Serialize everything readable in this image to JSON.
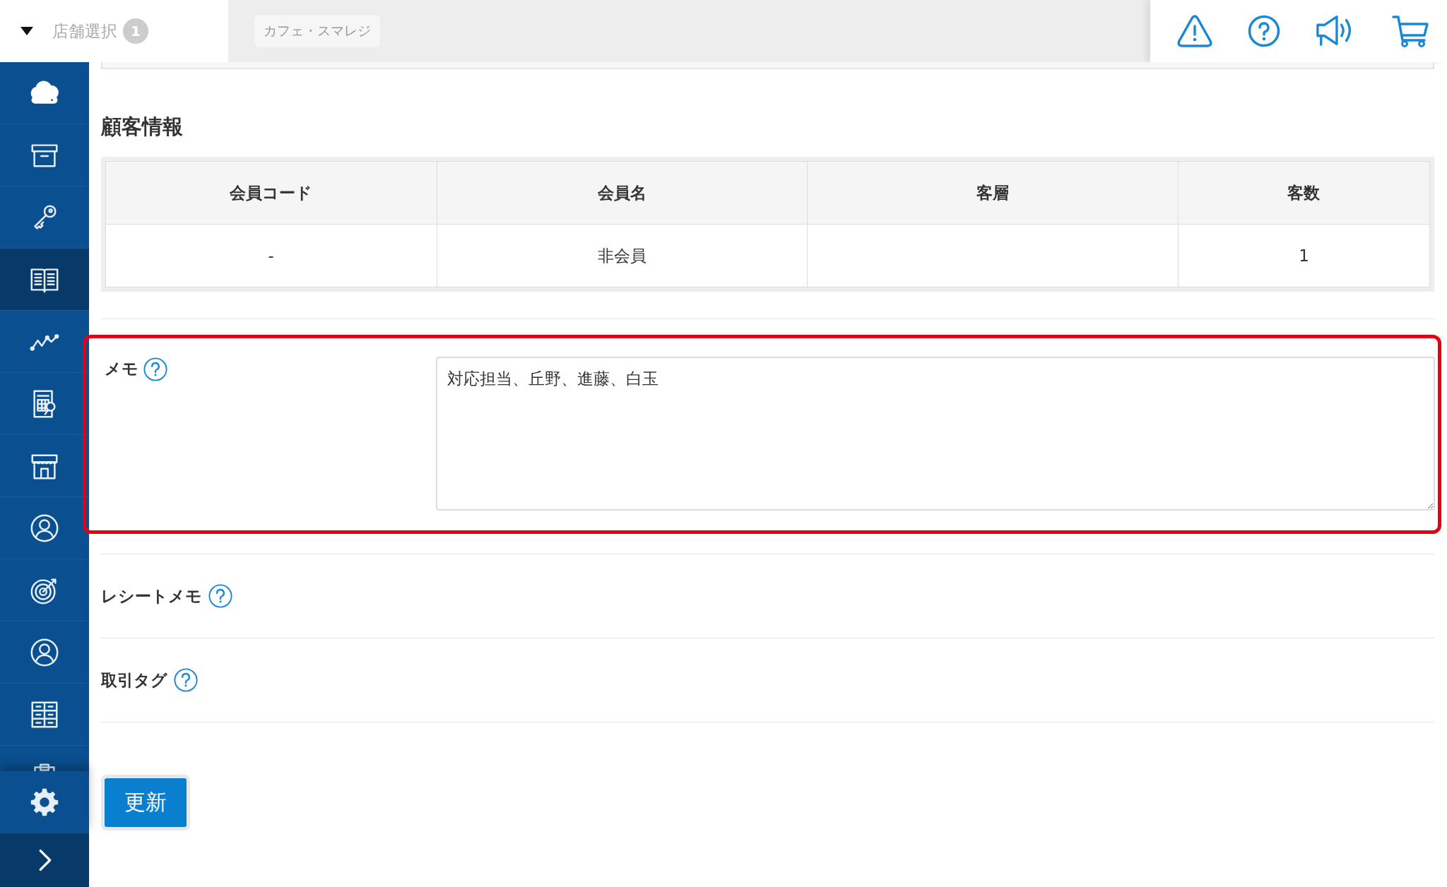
{
  "header": {
    "store_selector": {
      "label": "店舗選択",
      "badge": "1"
    },
    "store_chip": "カフェ・スマレジ"
  },
  "sidebar": {
    "items": [
      {
        "selected": false
      },
      {
        "selected": false
      },
      {
        "selected": false
      },
      {
        "selected": true
      },
      {
        "selected": false
      },
      {
        "selected": false
      },
      {
        "selected": false
      },
      {
        "selected": false
      },
      {
        "selected": false
      },
      {
        "selected": false
      },
      {
        "selected": false
      },
      {
        "selected": false
      }
    ]
  },
  "customer_section": {
    "title": "顧客情報",
    "table": {
      "columns": [
        "会員コード",
        "会員名",
        "客層",
        "客数"
      ],
      "rows": [
        [
          "-",
          "非会員",
          "",
          "1"
        ]
      ]
    }
  },
  "memo": {
    "label": "メモ",
    "value": "対応担当、丘野、進藤、白玉",
    "highlighted": true
  },
  "fields": [
    {
      "label": "レシートメモ"
    },
    {
      "label": "取引タグ"
    }
  ],
  "submit_button": "更新"
}
